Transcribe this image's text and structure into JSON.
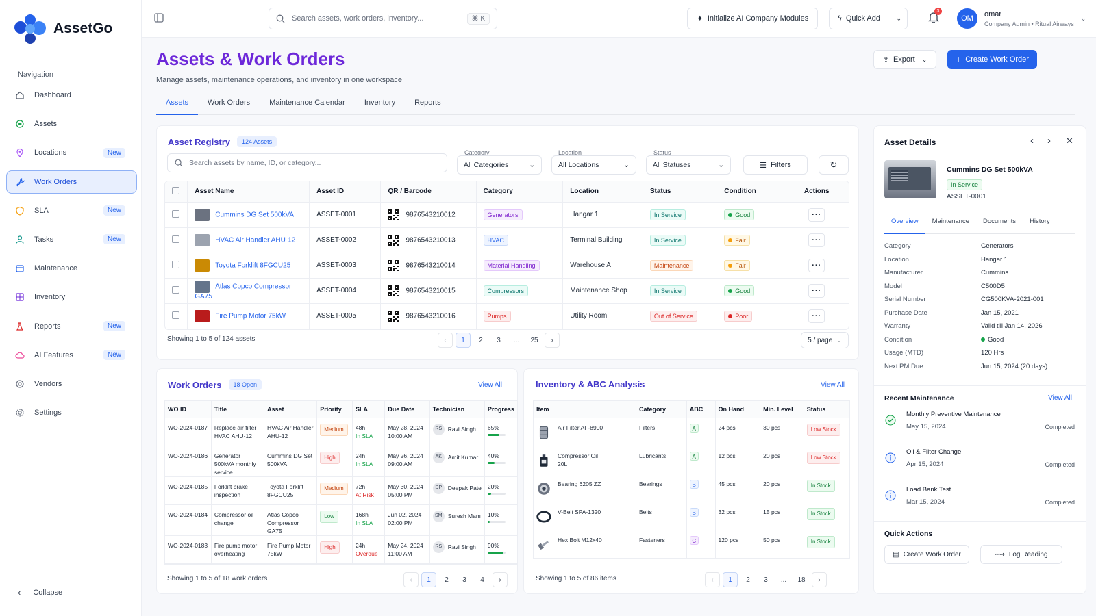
{
  "app": {
    "name": "AssetGo"
  },
  "nav": {
    "title": "Navigation",
    "items": [
      {
        "label": "Dashboard",
        "icon": "home-icon",
        "badge": ""
      },
      {
        "label": "Assets",
        "icon": "cube-icon",
        "badge": ""
      },
      {
        "label": "Locations",
        "icon": "location-pin-icon",
        "badge": "New"
      },
      {
        "label": "Work Orders",
        "icon": "wrench-icon",
        "badge": ""
      },
      {
        "label": "SLA",
        "icon": "shield-icon",
        "badge": "New"
      },
      {
        "label": "Tasks",
        "icon": "user-task-icon",
        "badge": "New"
      },
      {
        "label": "Maintenance",
        "icon": "calendar-icon",
        "badge": ""
      },
      {
        "label": "Inventory",
        "icon": "grid-icon",
        "badge": ""
      },
      {
        "label": "Reports",
        "icon": "flask-icon",
        "badge": "New"
      },
      {
        "label": "AI Features",
        "icon": "cloud-icon",
        "badge": "New"
      },
      {
        "label": "Vendors",
        "icon": "vendor-icon",
        "badge": ""
      },
      {
        "label": "Settings",
        "icon": "gear-icon",
        "badge": ""
      }
    ],
    "active_index": 3,
    "collapse_label": "Collapse"
  },
  "topbar": {
    "search_placeholder": "Search assets, work orders, inventory...",
    "shortcut": "⌘ K",
    "ai_button": "Initialize AI Company Modules",
    "quick_add": "Quick Add",
    "notif_count": "3",
    "user_initials": "OM",
    "user_name": "omar",
    "user_role": "Company Admin • Ritual Airways"
  },
  "page": {
    "title": "Assets & Work Orders",
    "subtitle": "Manage assets, maintenance operations, and inventory in one workspace",
    "export": "Export",
    "create": "Create Work Order",
    "tabs": [
      "Assets",
      "Work Orders",
      "Maintenance Calendar",
      "Inventory",
      "Reports"
    ]
  },
  "registry": {
    "title": "Asset Registry",
    "count": "124 Assets",
    "search_placeholder": "Search assets by name, ID, or category...",
    "filters": [
      {
        "label": "Category",
        "value": "All Categories"
      },
      {
        "label": "Location",
        "value": "All Locations"
      },
      {
        "label": "Status",
        "value": "All Statuses"
      }
    ],
    "filters_button": "Filters",
    "columns": [
      "Asset Name",
      "Asset ID",
      "QR / Barcode",
      "Category",
      "Location",
      "Status",
      "Condition",
      "Actions"
    ],
    "rows": [
      {
        "name": "Cummins DG Set 500kVA",
        "id": "ASSET-0001",
        "code": "9876543210012",
        "category": "Generators",
        "cat_style": "purple",
        "location": "Hangar 1",
        "status": "In Service",
        "status_style": "teal",
        "condition": "Good",
        "cond_color": "#16a34a",
        "cond_style": "green",
        "thumb": "#6b7280"
      },
      {
        "name": "HVAC Air Handler AHU-12",
        "id": "ASSET-0002",
        "code": "9876543210013",
        "category": "HVAC",
        "cat_style": "blue",
        "location": "Terminal Building",
        "status": "In Service",
        "status_style": "teal",
        "condition": "Fair",
        "cond_color": "#f59e0b",
        "cond_style": "yellow",
        "thumb": "#9ca3af"
      },
      {
        "name": "Toyota Forklift 8FGCU25",
        "id": "ASSET-0003",
        "code": "9876543210014",
        "category": "Material Handling",
        "cat_style": "purple",
        "location": "Warehouse A",
        "status": "Maintenance",
        "status_style": "orange",
        "condition": "Fair",
        "cond_color": "#f59e0b",
        "cond_style": "yellow",
        "thumb": "#ca8a04"
      },
      {
        "name": "Atlas Copco Compressor GA75",
        "id": "ASSET-0004",
        "code": "9876543210015",
        "category": "Compressors",
        "cat_style": "teal",
        "location": "Maintenance Shop",
        "status": "In Service",
        "status_style": "teal",
        "condition": "Good",
        "cond_color": "#16a34a",
        "cond_style": "green",
        "thumb": "#64748b"
      },
      {
        "name": "Fire Pump Motor 75kW",
        "id": "ASSET-0005",
        "code": "9876543210016",
        "category": "Pumps",
        "cat_style": "red",
        "location": "Utility Room",
        "status": "Out of Service",
        "status_style": "red",
        "condition": "Poor",
        "cond_color": "#dc2626",
        "cond_style": "red",
        "thumb": "#b91c1c"
      }
    ],
    "showing": "Showing 1 to 5 of 124 assets",
    "pages": [
      "1",
      "2",
      "3",
      "...",
      "25"
    ],
    "per_page": "5 / page"
  },
  "work_orders": {
    "title": "Work Orders",
    "count": "18 Open",
    "view_all": "View All",
    "columns": [
      "WO ID",
      "Title",
      "Asset",
      "Priority",
      "SLA",
      "Due Date",
      "Technician",
      "Progress"
    ],
    "rows": [
      {
        "id": "WO-2024-0187",
        "title": "Replace air filter HVAC AHU-12",
        "asset": "HVAC Air Handler AHU-12",
        "priority": "Medium",
        "pri_style": "orange",
        "sla_h": "48h",
        "sla": "In SLA",
        "sla_ok": true,
        "due": "May 28, 2024",
        "time": "10:00 AM",
        "tech_init": "RS",
        "tech": "Ravi Singh",
        "progress": "65%",
        "pct": 65
      },
      {
        "id": "WO-2024-0186",
        "title": "Generator 500kVA monthly service",
        "asset": "Cummins DG Set 500kVA",
        "priority": "High",
        "pri_style": "red",
        "sla_h": "24h",
        "sla": "In SLA",
        "sla_ok": true,
        "due": "May 26, 2024",
        "time": "09:00 AM",
        "tech_init": "AK",
        "tech": "Amit Kumar",
        "progress": "40%",
        "pct": 40
      },
      {
        "id": "WO-2024-0185",
        "title": "Forklift brake inspection",
        "asset": "Toyota Forklift 8FGCU25",
        "priority": "Medium",
        "pri_style": "orange",
        "sla_h": "72h",
        "sla": "At Risk",
        "sla_ok": false,
        "due": "May 30, 2024",
        "time": "05:00 PM",
        "tech_init": "DP",
        "tech": "Deepak Pate",
        "progress": "20%",
        "pct": 20
      },
      {
        "id": "WO-2024-0184",
        "title": "Compressor oil change",
        "asset": "Atlas Copco Compressor GA75",
        "priority": "Low",
        "pri_style": "green",
        "sla_h": "168h",
        "sla": "In SLA",
        "sla_ok": true,
        "due": "Jun 02, 2024",
        "time": "02:00 PM",
        "tech_init": "SM",
        "tech": "Suresh Manı",
        "progress": "10%",
        "pct": 10
      },
      {
        "id": "WO-2024-0183",
        "title": "Fire pump motor overheating",
        "asset": "Fire Pump Motor 75kW",
        "priority": "High",
        "pri_style": "red",
        "sla_h": "24h",
        "sla": "Overdue",
        "sla_ok": false,
        "due": "May 24, 2024",
        "time": "11:00 AM",
        "tech_init": "RS",
        "tech": "Ravi Singh",
        "progress": "90%",
        "pct": 90
      }
    ],
    "showing": "Showing 1 to 5 of 18 work orders",
    "pages": [
      "1",
      "2",
      "3",
      "4"
    ]
  },
  "inventory": {
    "title": "Inventory & ABC Analysis",
    "view_all": "View All",
    "columns": [
      "Item",
      "Category",
      "ABC",
      "On Hand",
      "Min. Level",
      "Status"
    ],
    "rows": [
      {
        "item": "Air Filter AF-8900",
        "category": "Filters",
        "abc": "A",
        "on_hand": "24 pcs",
        "min": "30 pcs",
        "status": "Low Stock",
        "st_style": "red",
        "icon": "filter-icon"
      },
      {
        "item": "Compressor Oil 20L",
        "category": "Lubricants",
        "abc": "A",
        "on_hand": "12 pcs",
        "min": "20 pcs",
        "status": "Low Stock",
        "st_style": "red",
        "icon": "oil-can-icon"
      },
      {
        "item": "Bearing 6205 ZZ",
        "category": "Bearings",
        "abc": "B",
        "on_hand": "45 pcs",
        "min": "20 pcs",
        "status": "In Stock",
        "st_style": "green",
        "icon": "bearing-icon"
      },
      {
        "item": "V-Belt SPA-1320",
        "category": "Belts",
        "abc": "B",
        "on_hand": "32 pcs",
        "min": "15 pcs",
        "status": "In Stock",
        "st_style": "green",
        "icon": "belt-icon"
      },
      {
        "item": "Hex Bolt M12x40",
        "category": "Fasteners",
        "abc": "C",
        "on_hand": "120 pcs",
        "min": "50 pcs",
        "status": "In Stock",
        "st_style": "green",
        "icon": "bolt-icon"
      }
    ],
    "showing": "Showing 1 to 5 of 86 items",
    "pages": [
      "1",
      "2",
      "3",
      "...",
      "18"
    ]
  },
  "details": {
    "title": "Asset Details",
    "name": "Cummins DG Set 500kVA",
    "status": "In Service",
    "id": "ASSET-0001",
    "tabs": [
      "Overview",
      "Maintenance",
      "Documents",
      "History"
    ],
    "fields": [
      {
        "k": "Category",
        "v": "Generators"
      },
      {
        "k": "Location",
        "v": "Hangar 1"
      },
      {
        "k": "Manufacturer",
        "v": "Cummins"
      },
      {
        "k": "Model",
        "v": "C500D5"
      },
      {
        "k": "Serial Number",
        "v": "CG500KVA-2021-001"
      },
      {
        "k": "Purchase Date",
        "v": "Jan 15, 2021"
      },
      {
        "k": "Warranty",
        "v": "Valid till Jan 14, 2026"
      },
      {
        "k": "Condition",
        "v": "Good"
      },
      {
        "k": "Usage (MTD)",
        "v": "120 Hrs"
      },
      {
        "k": "Next PM Due",
        "v": "Jun 15, 2024 (20 days)"
      }
    ],
    "recent_title": "Recent Maintenance",
    "recent_view_all": "View All",
    "recent": [
      {
        "title": "Monthly Preventive Maintenance",
        "date": "May 15, 2024",
        "status": "Completed",
        "icon": "check-circle-icon"
      },
      {
        "title": "Oil & Filter Change",
        "date": "Apr 15, 2024",
        "status": "Completed",
        "icon": "info-circle-icon"
      },
      {
        "title": "Load Bank Test",
        "date": "Mar 15, 2024",
        "status": "Completed",
        "icon": "info-circle-icon"
      }
    ],
    "quick_title": "Quick Actions",
    "quick": [
      "Create Work Order",
      "Log Reading"
    ]
  },
  "colors": {
    "accent": "#2563eb",
    "title": "#6d28d9",
    "good": "#16a34a",
    "fair": "#f59e0b",
    "poor": "#dc2626"
  }
}
